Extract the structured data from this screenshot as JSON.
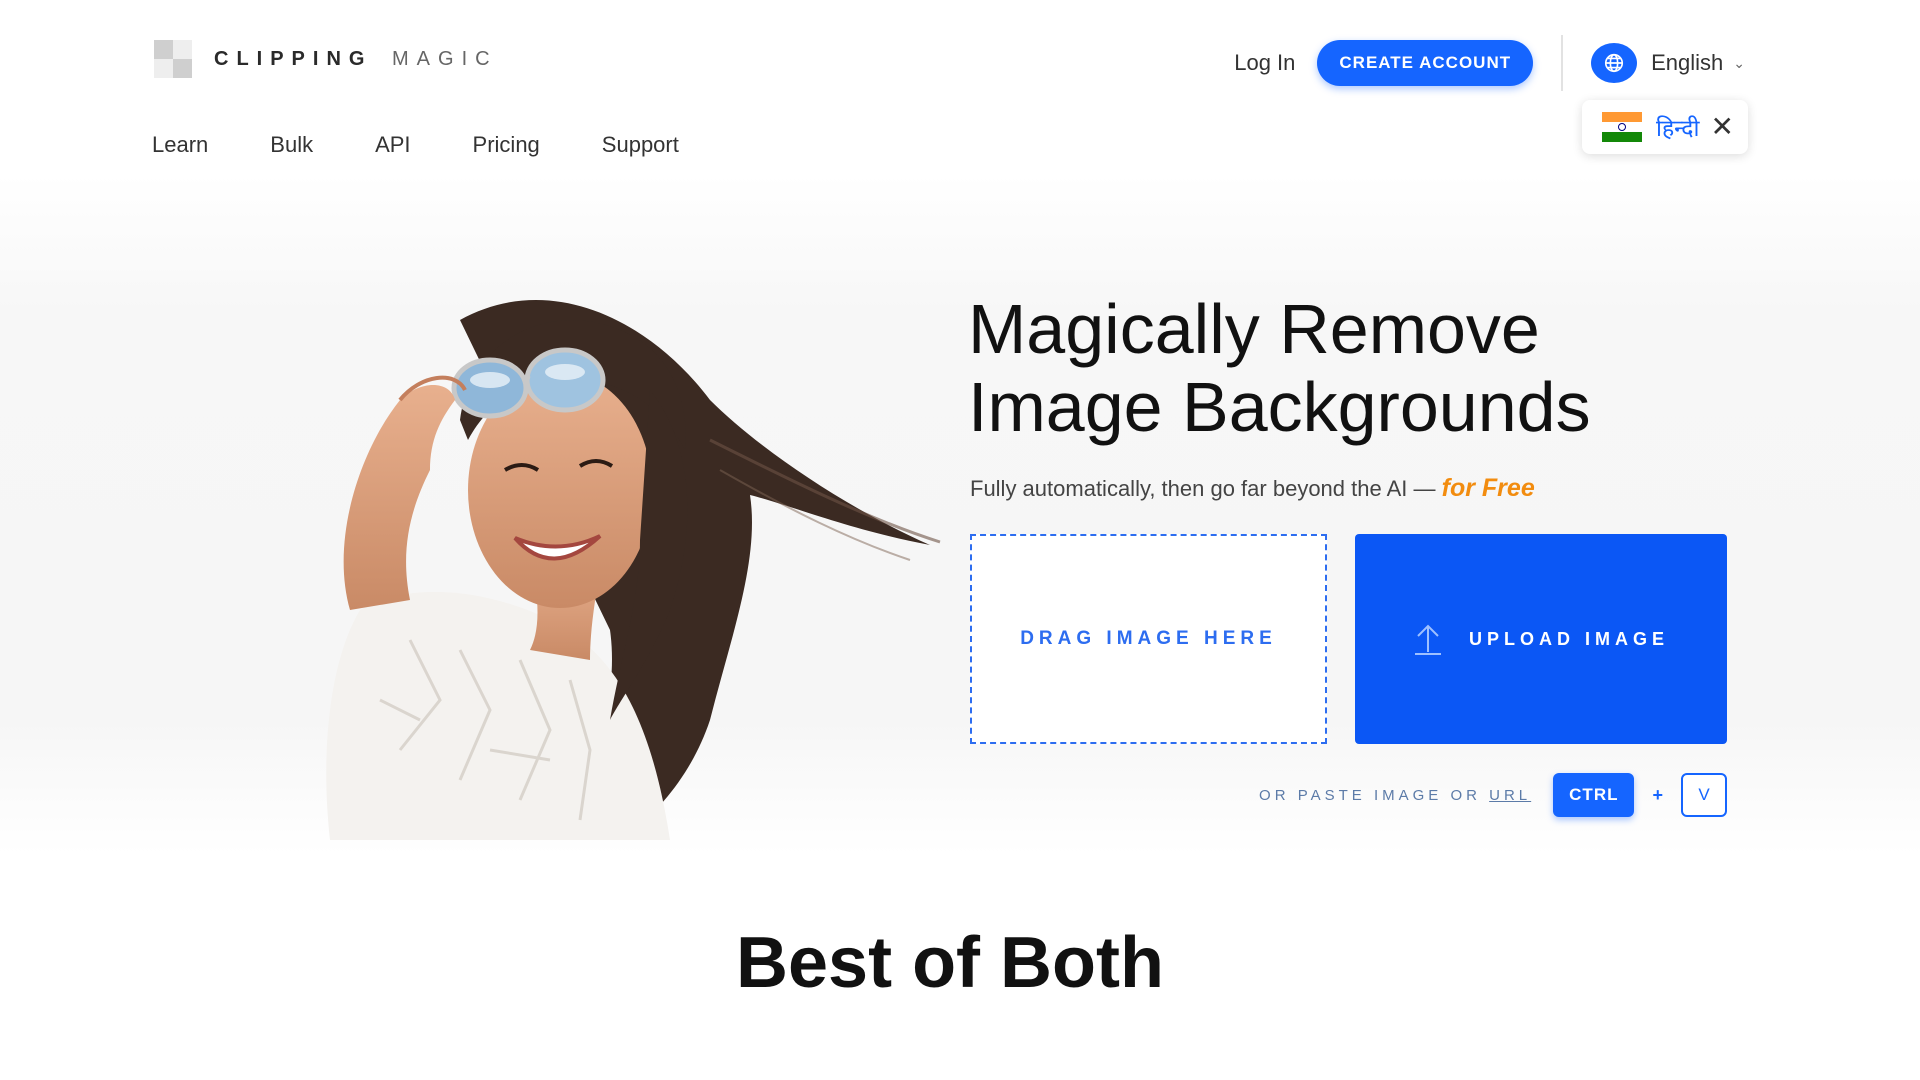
{
  "header": {
    "logo": {
      "brand": "CLIPPING",
      "brand_light": "MAGIC"
    },
    "nav": [
      "Learn",
      "Bulk",
      "API",
      "Pricing",
      "Support"
    ],
    "login_label": "Log In",
    "create_account_label": "CREATE ACCOUNT",
    "language": {
      "icon": "globe-icon",
      "current": "English"
    },
    "language_suggestion": {
      "flag": "india-flag-icon",
      "label": "हिन्दी",
      "close_icon": "close-icon"
    }
  },
  "hero": {
    "headline_line1": "Magically Remove",
    "headline_line2": "Image Backgrounds",
    "subline": "Fully automatically, then go far beyond the AI —",
    "subline_emphasis": "for Free",
    "drag_label": "DRAG IMAGE HERE",
    "upload_label": "UPLOAD IMAGE",
    "upload_icon": "upload-arrow-icon",
    "paste_prefix": "OR PASTE IMAGE OR",
    "paste_url": "URL",
    "key_ctrl": "CTRL",
    "key_plus": "+",
    "key_v": "V"
  },
  "section": {
    "title": "Best of Both"
  },
  "colors": {
    "accent": "#1565ff",
    "upload_bg": "#0b57f5",
    "emphasis": "#f28c0f"
  }
}
